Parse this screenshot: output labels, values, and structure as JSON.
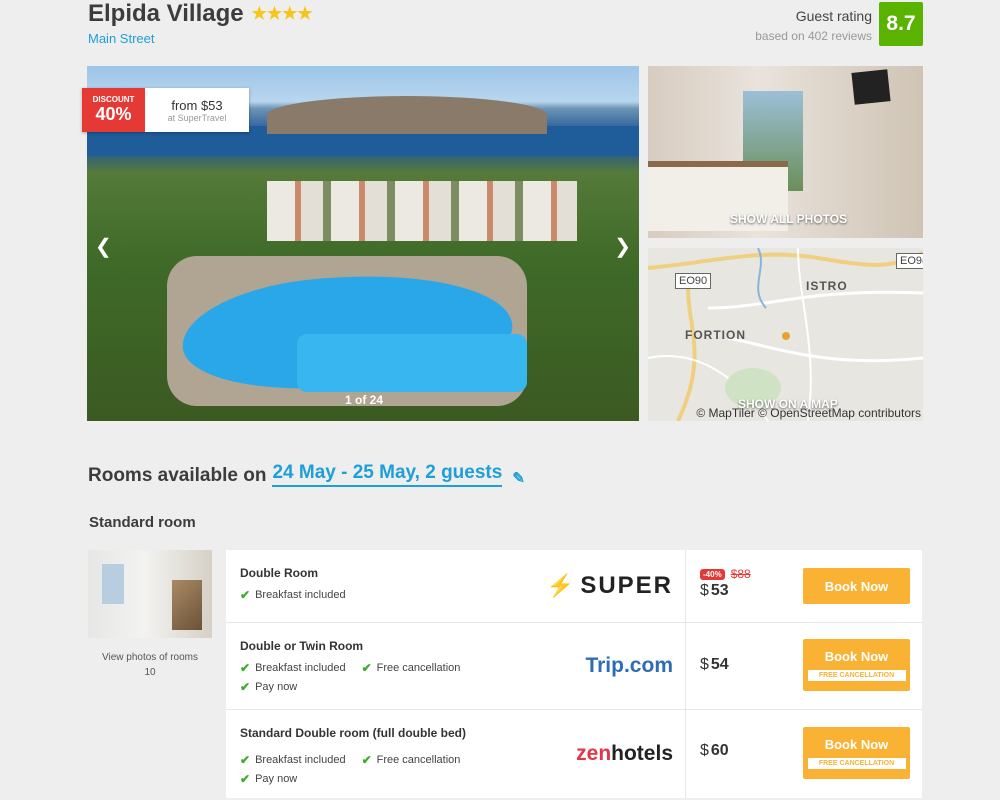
{
  "hotel": {
    "name": "Elpida Village",
    "stars": "★★★★",
    "street": "Main Street"
  },
  "rating": {
    "label": "Guest rating",
    "reviews": "based on 402 reviews",
    "score": "8.7",
    "score_color": "#59b300"
  },
  "gallery": {
    "discount_label": "DISCOUNT",
    "discount_pct": "40%",
    "from_price": "from $53",
    "provider": "at SuperTravel",
    "counter": "1 of 24",
    "prev_icon": "chevron-left-icon",
    "next_icon": "chevron-right-icon",
    "show_all": "SHOW ALL PHOTOS",
    "show_map": "SHOW ON A MAP"
  },
  "map": {
    "road1": "EO90",
    "road2": "EO9(",
    "town1": "ISTRO",
    "town2": "FORTION",
    "attribution": "© MapTiler © OpenStreetMap contributors"
  },
  "availability": {
    "prefix": "Rooms available on",
    "dates": "24 May - 25 May, 2 guests",
    "edit_icon": "pencil-icon"
  },
  "room_section": {
    "title": "Standard room",
    "view_photos": "View photos of rooms 10"
  },
  "offers": [
    {
      "name": "Double Room",
      "features": [
        "Breakfast included"
      ],
      "provider": "SUPER",
      "discount_badge": "-40%",
      "old_price": "$88",
      "currency": "$",
      "price": "53",
      "book_label": "Book Now",
      "free_cancel": ""
    },
    {
      "name": "Double or Twin Room",
      "features": [
        "Breakfast included",
        "Free cancellation",
        "Pay now"
      ],
      "provider": "Trip.com",
      "currency": "$",
      "price": "54",
      "book_label": "Book Now",
      "free_cancel": "FREE CANCELLATION"
    },
    {
      "name": "Standard Double room (full double bed)",
      "features": [
        "Breakfast included",
        "Free cancellation",
        "Pay now"
      ],
      "provider_zen": "zen",
      "provider_hotels": "hotels",
      "currency": "$",
      "price": "60",
      "book_label": "Book Now",
      "free_cancel": "FREE CANCELLATION"
    }
  ],
  "colors": {
    "accent": "#1e9fd8",
    "book": "#f9b234",
    "discount": "#e53935",
    "check": "#3cab2f"
  }
}
